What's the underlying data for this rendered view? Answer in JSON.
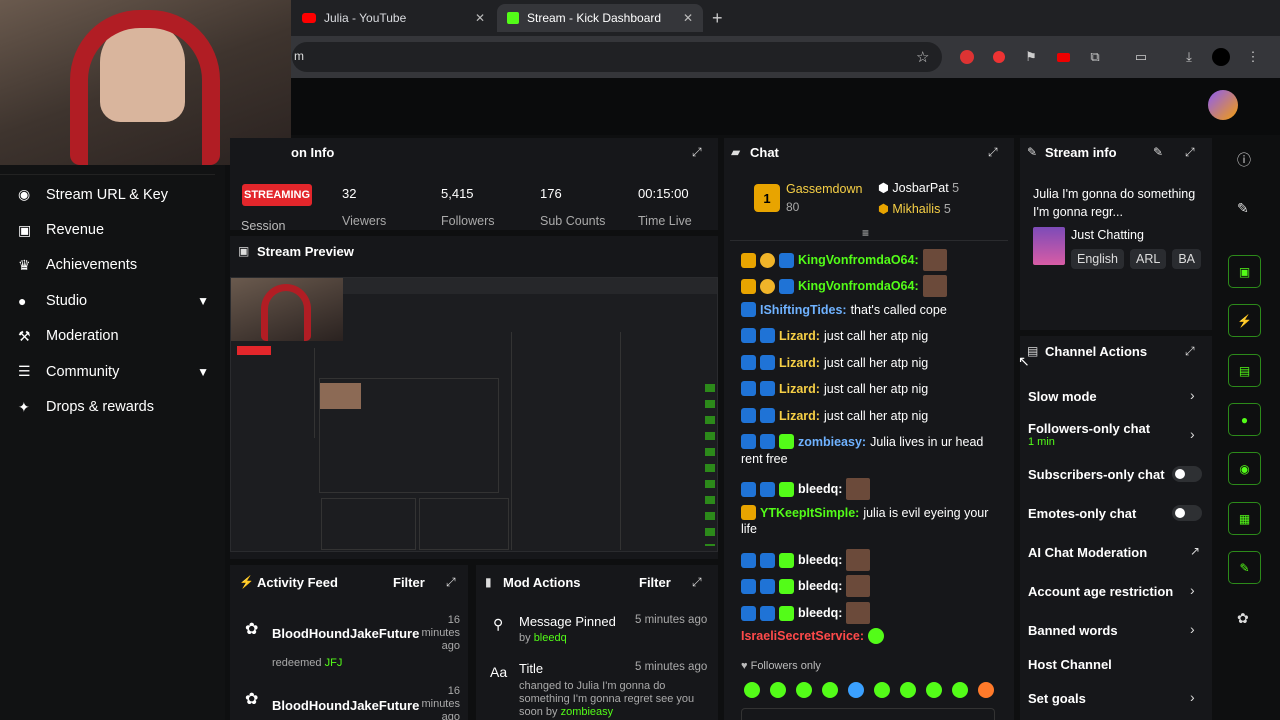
{
  "browser": {
    "tabs": [
      {
        "title": "Julia - YouTube"
      },
      {
        "title": "Stream - Kick Dashboard"
      }
    ],
    "new_tab": "+",
    "address_fragment": "m"
  },
  "sidebar": {
    "items": [
      {
        "label": "Stream URL & Key",
        "icon": "broadcast-icon"
      },
      {
        "label": "Revenue",
        "icon": "wallet-icon"
      },
      {
        "label": "Achievements",
        "icon": "trophy-icon"
      },
      {
        "label": "Studio",
        "icon": "microphone-icon",
        "chevron": true
      },
      {
        "label": "Moderation",
        "icon": "gavel-icon"
      },
      {
        "label": "Community",
        "icon": "people-icon",
        "chevron": true
      },
      {
        "label": "Drops & rewards",
        "icon": "gift-icon"
      }
    ]
  },
  "session": {
    "title_fragment": "on Info",
    "status": "STREAMING",
    "session_label": "Session",
    "stats": [
      {
        "value": "32",
        "label": "Viewers"
      },
      {
        "value": "5,415",
        "label": "Followers"
      },
      {
        "value": "176",
        "label": "Sub Counts"
      },
      {
        "value": "00:15:00",
        "label": "Time Live"
      }
    ]
  },
  "preview": {
    "title": "Stream Preview"
  },
  "activity": {
    "title": "Activity Feed",
    "filter": "Filter",
    "items": [
      {
        "user": "BloodHoundJakeFuture",
        "time": "16 minutes ago",
        "action": "redeemed",
        "reward": "JFJ"
      },
      {
        "user": "BloodHoundJakeFuture",
        "time": "16 minutes ago"
      }
    ]
  },
  "mod_actions": {
    "title": "Mod Actions",
    "filter": "Filter",
    "items": [
      {
        "title": "Message Pinned",
        "time": "5 minutes ago",
        "by": "by",
        "user": "bleedq"
      },
      {
        "title": "Title",
        "time": "5 minutes ago",
        "detail": "changed to Julia I'm gonna do something I'm gonna regret see you soon by",
        "user": "zombieasy"
      }
    ]
  },
  "chat": {
    "title": "Chat",
    "top_gifters": [
      {
        "name": "Gassemdown",
        "count": "80"
      },
      {
        "name": "JosbarPat",
        "count": "5"
      },
      {
        "name": "Mikhailis",
        "count": "5"
      }
    ],
    "messages": [
      {
        "user": "KingVonfromdaO64:",
        "text": ""
      },
      {
        "user": "KingVonfromdaO64:",
        "text": ""
      },
      {
        "user": "IShiftingTides:",
        "text": "that's called cope"
      },
      {
        "user": "Lizard:",
        "text": "just call her atp nig"
      },
      {
        "user": "Lizard:",
        "text": "just call her atp nig"
      },
      {
        "user": "Lizard:",
        "text": "just call her atp nig"
      },
      {
        "user": "Lizard:",
        "text": "just call her atp nig"
      },
      {
        "user": "zombieasy:",
        "text": "Julia lives in ur head"
      },
      {
        "user": "",
        "text": "rent free"
      },
      {
        "user": "bleedq:",
        "text": ""
      },
      {
        "user": "YTKeepItSimple:",
        "text": "julia is evil eyeing your"
      },
      {
        "user": "",
        "text": "life"
      },
      {
        "user": "bleedq:",
        "text": ""
      },
      {
        "user": "bleedq:",
        "text": ""
      },
      {
        "user": "bleedq:",
        "text": ""
      },
      {
        "user": "IsraeliSecretService:",
        "text": ""
      }
    ],
    "mode": "Followers only"
  },
  "stream_info": {
    "title": "Stream info",
    "stream_title": "Julia I'm gonna do something I'm gonna regr...",
    "category": "Just Chatting",
    "tags": [
      "English",
      "ARL",
      "BA"
    ]
  },
  "channel_actions": {
    "title": "Channel Actions",
    "items": [
      {
        "label": "Slow mode",
        "control": "chevron"
      },
      {
        "label": "Followers-only chat",
        "sub": "1 min",
        "control": "chevron"
      },
      {
        "label": "Subscribers-only chat",
        "control": "toggle"
      },
      {
        "label": "Emotes-only chat",
        "control": "toggle"
      },
      {
        "label": "AI Chat Moderation",
        "control": "external"
      },
      {
        "label": "Account age restriction",
        "control": "chevron"
      },
      {
        "label": "Banned words",
        "control": "chevron"
      },
      {
        "label": "Host Channel",
        "control": "none"
      },
      {
        "label": "Set goals",
        "control": "chevron"
      }
    ]
  },
  "colors": {
    "accent": "#53fc18",
    "streaming": "#e3262b",
    "panel": "#16171a"
  }
}
